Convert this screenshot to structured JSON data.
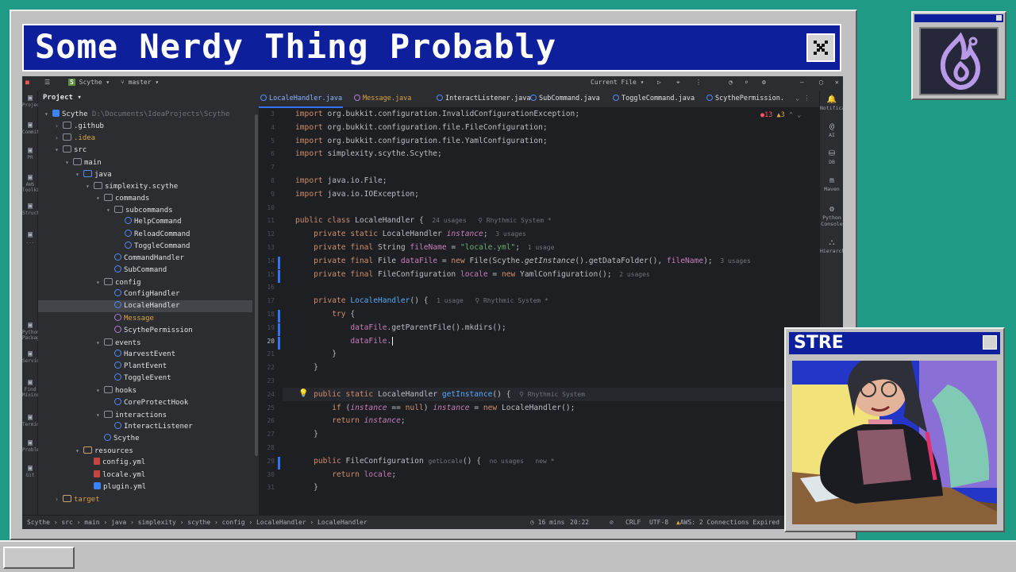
{
  "overlay": {
    "title": "Some Nerdy Thing Probably",
    "stream_title": "STRE"
  },
  "ide": {
    "topbar": {
      "project": "Scythe",
      "branch": "master",
      "run_config": "Current File"
    },
    "left_strip": [
      {
        "icon": "folder-icon",
        "label": "Project"
      },
      {
        "icon": "commit-icon",
        "label": "Commit"
      },
      {
        "icon": "pull-request-icon",
        "label": "PR"
      },
      {
        "icon": "aws-icon",
        "label": "AWS Toolkit"
      },
      {
        "icon": "structure-icon",
        "label": "Structure"
      },
      {
        "icon": "more-icon",
        "label": "..."
      },
      {
        "icon": "python-packages-icon",
        "label": "Python Packages"
      },
      {
        "icon": "services-icon",
        "label": "Services"
      },
      {
        "icon": "find-icon",
        "label": "Find Mixins"
      },
      {
        "icon": "terminal-icon",
        "label": "Terminal"
      },
      {
        "icon": "problems-icon",
        "label": "Problems"
      },
      {
        "icon": "git-icon",
        "label": "Git"
      }
    ],
    "project_panel": {
      "header": "Project",
      "tree": [
        {
          "indent": 0,
          "arrow": "▾",
          "icon": "proj",
          "label": "Scythe",
          "extra": "D:\\Documents\\IdeaProjects\\Scythe"
        },
        {
          "indent": 1,
          "arrow": "›",
          "icon": "folder",
          "label": ".github"
        },
        {
          "indent": 1,
          "arrow": "›",
          "icon": "folder",
          "label": ".idea",
          "color": "orange"
        },
        {
          "indent": 1,
          "arrow": "▾",
          "icon": "folder",
          "label": "src"
        },
        {
          "indent": 2,
          "arrow": "▾",
          "icon": "folder",
          "label": "main"
        },
        {
          "indent": 3,
          "arrow": "▾",
          "icon": "folder-src",
          "label": "java"
        },
        {
          "indent": 4,
          "arrow": "▾",
          "icon": "folder",
          "label": "simplexity.scythe"
        },
        {
          "indent": 5,
          "arrow": "▾",
          "icon": "folder",
          "label": "commands"
        },
        {
          "indent": 6,
          "arrow": "▾",
          "icon": "folder",
          "label": "subcommands"
        },
        {
          "indent": 7,
          "arrow": "",
          "icon": "cls",
          "label": "HelpCommand"
        },
        {
          "indent": 7,
          "arrow": "",
          "icon": "cls",
          "label": "ReloadCommand"
        },
        {
          "indent": 7,
          "arrow": "",
          "icon": "cls",
          "label": "ToggleCommand"
        },
        {
          "indent": 6,
          "arrow": "",
          "icon": "cls",
          "label": "CommandHandler"
        },
        {
          "indent": 6,
          "arrow": "",
          "icon": "cls",
          "label": "SubCommand"
        },
        {
          "indent": 5,
          "arrow": "▾",
          "icon": "folder",
          "label": "config"
        },
        {
          "indent": 6,
          "arrow": "",
          "icon": "cls",
          "label": "ConfigHandler"
        },
        {
          "indent": 6,
          "arrow": "",
          "icon": "cls",
          "label": "LocaleHandler",
          "selected": true
        },
        {
          "indent": 6,
          "arrow": "",
          "icon": "enum",
          "label": "Message",
          "color": "orange"
        },
        {
          "indent": 6,
          "arrow": "",
          "icon": "enum",
          "label": "ScythePermission"
        },
        {
          "indent": 5,
          "arrow": "▾",
          "icon": "folder",
          "label": "events"
        },
        {
          "indent": 6,
          "arrow": "",
          "icon": "cls",
          "label": "HarvestEvent"
        },
        {
          "indent": 6,
          "arrow": "",
          "icon": "cls",
          "label": "PlantEvent"
        },
        {
          "indent": 6,
          "arrow": "",
          "icon": "cls",
          "label": "ToggleEvent"
        },
        {
          "indent": 5,
          "arrow": "▾",
          "icon": "folder",
          "label": "hooks"
        },
        {
          "indent": 6,
          "arrow": "",
          "icon": "cls",
          "label": "CoreProtectHook"
        },
        {
          "indent": 5,
          "arrow": "▾",
          "icon": "folder",
          "label": "interactions"
        },
        {
          "indent": 6,
          "arrow": "",
          "icon": "cls",
          "label": "InteractListener"
        },
        {
          "indent": 5,
          "arrow": "",
          "icon": "cls",
          "label": "Scythe"
        },
        {
          "indent": 3,
          "arrow": "▾",
          "icon": "folder-res",
          "label": "resources"
        },
        {
          "indent": 4,
          "arrow": "",
          "icon": "yml",
          "label": "config.yml"
        },
        {
          "indent": 4,
          "arrow": "",
          "icon": "yml",
          "label": "locale.yml"
        },
        {
          "indent": 4,
          "arrow": "",
          "icon": "plug",
          "label": "plugin.yml"
        },
        {
          "indent": 1,
          "arrow": "›",
          "icon": "folder-res",
          "label": "target",
          "color": "orange"
        }
      ]
    },
    "tabs": [
      {
        "label": "LocaleHandler.java",
        "active": true
      },
      {
        "label": "Message.java",
        "color": "orange"
      },
      {
        "label": "InteractListener.java"
      },
      {
        "label": "SubCommand.java"
      },
      {
        "label": "ToggleCommand.java"
      },
      {
        "label": "ScythePermission."
      }
    ],
    "inspections": {
      "errors": "13",
      "warnings": "3"
    },
    "editor_lines": [
      {
        "n": "3",
        "tokens": [
          [
            "kw",
            "import "
          ],
          [
            "",
            "org.bukkit.configuration.InvalidConfigurationException;"
          ]
        ]
      },
      {
        "n": "4",
        "tokens": [
          [
            "kw",
            "import "
          ],
          [
            "",
            "org.bukkit.configuration.file.FileConfiguration;"
          ]
        ]
      },
      {
        "n": "5",
        "tokens": [
          [
            "kw",
            "import "
          ],
          [
            "",
            "org.bukkit.configuration.file.YamlConfiguration;"
          ]
        ]
      },
      {
        "n": "6",
        "tokens": [
          [
            "kw",
            "import "
          ],
          [
            "",
            "simplexity.scythe.Scythe;"
          ]
        ]
      },
      {
        "n": "7",
        "tokens": []
      },
      {
        "n": "8",
        "tokens": [
          [
            "kw",
            "import "
          ],
          [
            "",
            "java.io.File;"
          ]
        ]
      },
      {
        "n": "9",
        "tokens": [
          [
            "kw",
            "import "
          ],
          [
            "",
            "java.io.IOException;"
          ]
        ]
      },
      {
        "n": "10",
        "tokens": []
      },
      {
        "n": "11",
        "tokens": [
          [
            "kw",
            "public class "
          ],
          [
            "",
            "LocaleHandler { "
          ],
          [
            "hint",
            " 24 usages   ⚲ Rhythmic System *"
          ]
        ]
      },
      {
        "n": "12",
        "tokens": [
          [
            "",
            "    "
          ],
          [
            "kw",
            "private static "
          ],
          [
            "",
            "LocaleHandler "
          ],
          [
            "fld it",
            "instance"
          ],
          [
            "",
            ";"
          ],
          [
            "hint",
            "  3 usages"
          ]
        ]
      },
      {
        "n": "13",
        "tokens": [
          [
            "",
            "    "
          ],
          [
            "kw",
            "private final "
          ],
          [
            "",
            "String "
          ],
          [
            "fld",
            "fileName"
          ],
          [
            "",
            " = "
          ],
          [
            "str",
            "\"locale.yml\""
          ],
          [
            "",
            ";"
          ],
          [
            "hint",
            "  1 usage"
          ]
        ]
      },
      {
        "n": "14",
        "tokens": [
          [
            "",
            "    "
          ],
          [
            "kw",
            "private final "
          ],
          [
            "",
            "File "
          ],
          [
            "fld",
            "dataFile"
          ],
          [
            "",
            " = "
          ],
          [
            "kw",
            "new "
          ],
          [
            "",
            "File(Scythe."
          ],
          [
            "it",
            "getInstance"
          ],
          [
            "",
            "().getDataFolder(), "
          ],
          [
            "fld",
            "fileName"
          ],
          [
            "",
            ");"
          ],
          [
            "hint",
            "  3 usages"
          ]
        ]
      },
      {
        "n": "15",
        "tokens": [
          [
            "",
            "    "
          ],
          [
            "kw",
            "private final "
          ],
          [
            "",
            "FileConfiguration "
          ],
          [
            "fld",
            "locale"
          ],
          [
            "",
            " = "
          ],
          [
            "kw",
            "new "
          ],
          [
            "",
            "YamlConfiguration();"
          ],
          [
            "hint",
            "  2 usages"
          ]
        ]
      },
      {
        "n": "16",
        "tokens": []
      },
      {
        "n": "17",
        "tokens": [
          [
            "",
            "    "
          ],
          [
            "kw",
            "private "
          ],
          [
            "fn",
            "LocaleHandler"
          ],
          [
            "",
            "() { "
          ],
          [
            "hint",
            " 1 usage   ⚲ Rhythmic System *"
          ]
        ]
      },
      {
        "n": "18",
        "tokens": [
          [
            "",
            "        "
          ],
          [
            "kw",
            "try "
          ],
          [
            "",
            "{"
          ]
        ]
      },
      {
        "n": "19",
        "tokens": [
          [
            "",
            "            "
          ],
          [
            "fld",
            "dataFile"
          ],
          [
            "",
            ".getParentFile()."
          ],
          [
            "",
            "mkdirs"
          ],
          [
            "",
            "();"
          ]
        ]
      },
      {
        "n": "20",
        "tokens": [
          [
            "",
            "            "
          ],
          [
            "fld",
            "dataFile"
          ],
          [
            "",
            "."
          ]
        ]
      },
      {
        "n": "21",
        "tokens": [
          [
            "",
            "        }"
          ]
        ]
      },
      {
        "n": "22",
        "tokens": [
          [
            "",
            "    }"
          ]
        ]
      },
      {
        "n": "23",
        "tokens": []
      },
      {
        "n": "24",
        "tokens": [
          [
            "",
            "    "
          ],
          [
            "kw",
            "public static "
          ],
          [
            "",
            "LocaleHandler "
          ],
          [
            "fn",
            "getInstance"
          ],
          [
            "",
            "() { "
          ],
          [
            "hint",
            " ⚲ Rhythmic System"
          ]
        ]
      },
      {
        "n": "25",
        "tokens": [
          [
            "",
            "        "
          ],
          [
            "kw",
            "if "
          ],
          [
            "",
            "("
          ],
          [
            "fld it",
            "instance"
          ],
          [
            "",
            " == "
          ],
          [
            "kw",
            "null"
          ],
          [
            "",
            ") "
          ],
          [
            "fld it",
            "instance"
          ],
          [
            "",
            " = "
          ],
          [
            "kw",
            "new "
          ],
          [
            "",
            "LocaleHandler();"
          ]
        ]
      },
      {
        "n": "26",
        "tokens": [
          [
            "",
            "        "
          ],
          [
            "kw",
            "return "
          ],
          [
            "fld it",
            "instance"
          ],
          [
            "",
            ";"
          ]
        ]
      },
      {
        "n": "27",
        "tokens": [
          [
            "",
            "    }"
          ]
        ]
      },
      {
        "n": "28",
        "tokens": []
      },
      {
        "n": "29",
        "tokens": [
          [
            "",
            "    "
          ],
          [
            "kw",
            "public "
          ],
          [
            "",
            "FileConfiguration "
          ],
          [
            "hint",
            "getLocale"
          ],
          [
            "",
            "() { "
          ],
          [
            "hint",
            " no usages   new *"
          ]
        ]
      },
      {
        "n": "30",
        "tokens": [
          [
            "",
            "        "
          ],
          [
            "kw",
            "return "
          ],
          [
            "fld",
            "locale"
          ],
          [
            "",
            ";"
          ]
        ]
      },
      {
        "n": "31",
        "tokens": [
          [
            "",
            "    }"
          ]
        ]
      }
    ],
    "right_strip": [
      {
        "icon": "bell-icon",
        "label": "Notifica"
      },
      {
        "icon": "ai-icon",
        "label": "AI"
      },
      {
        "icon": "db-icon",
        "label": "DB"
      },
      {
        "icon": "maven-icon",
        "label": "Maven"
      },
      {
        "icon": "python-console-icon",
        "label": "Python Console"
      },
      {
        "icon": "hierarchy-icon",
        "label": "Hierarch"
      }
    ],
    "statusbar": {
      "breadcrumb": "Scythe › src › main › java › simplexity › scythe › config › LocaleHandler › LocaleHandler",
      "time_ago": "16 mins",
      "position": "20:22",
      "line_sep": "CRLF",
      "encoding": "UTF-8",
      "aws": "AWS: 2 Connections Expired"
    }
  }
}
